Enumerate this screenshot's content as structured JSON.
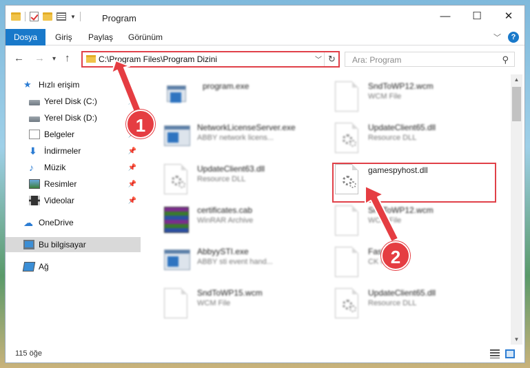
{
  "window": {
    "title": "Program"
  },
  "ribbon": {
    "tabs": [
      "Dosya",
      "Giriş",
      "Paylaş",
      "Görünüm"
    ]
  },
  "address": {
    "path": "C:\\Program Files\\Program Dizini"
  },
  "search": {
    "placeholder": "Ara: Program"
  },
  "sidebar": {
    "items": [
      {
        "label": "Hızlı erişim",
        "icon": "star-icon"
      },
      {
        "label": "Yerel Disk (C:)",
        "icon": "drive-icon"
      },
      {
        "label": "Yerel Disk (D:)",
        "icon": "drive-icon"
      },
      {
        "label": "Belgeler",
        "icon": "document-icon"
      },
      {
        "label": "İndirmeler",
        "icon": "download-icon"
      },
      {
        "label": "Müzik",
        "icon": "music-icon"
      },
      {
        "label": "Resimler",
        "icon": "pictures-icon"
      },
      {
        "label": "Videolar",
        "icon": "video-icon"
      },
      {
        "label": "OneDrive",
        "icon": "cloud-icon"
      },
      {
        "label": "Bu bilgisayar",
        "icon": "computer-icon"
      },
      {
        "label": "Ağ",
        "icon": "network-icon"
      }
    ]
  },
  "files": [
    {
      "name": "program.exe",
      "type": ""
    },
    {
      "name": "SndToWP12.wcm",
      "type": "WCM File"
    },
    {
      "name": "NetworkLicenseServer.exe",
      "type": "ABBY network licens..."
    },
    {
      "name": "UpdateClient65.dll",
      "type": "Resource DLL"
    },
    {
      "name": "UpdateClient63.dll",
      "type": "Resource DLL"
    },
    {
      "name": "gamespyhost.dll",
      "type": ""
    },
    {
      "name": "certificates.cab",
      "type": "WinRAR Archive"
    },
    {
      "name": "SndToWP12.wcm",
      "type": "WCM File"
    },
    {
      "name": "AbbyySTI.exe",
      "type": "ABBY sti event hand..."
    },
    {
      "name": "FastKa...",
      "type": "CK File"
    },
    {
      "name": "SndToWP15.wcm",
      "type": "WCM File"
    },
    {
      "name": "UpdateClient65.dll",
      "type": "Resource DLL"
    }
  ],
  "status": {
    "count": "115 öğe"
  },
  "annotations": {
    "step1": "1",
    "step2": "2"
  },
  "colors": {
    "accent": "#1979ca",
    "highlight": "#e04048"
  }
}
